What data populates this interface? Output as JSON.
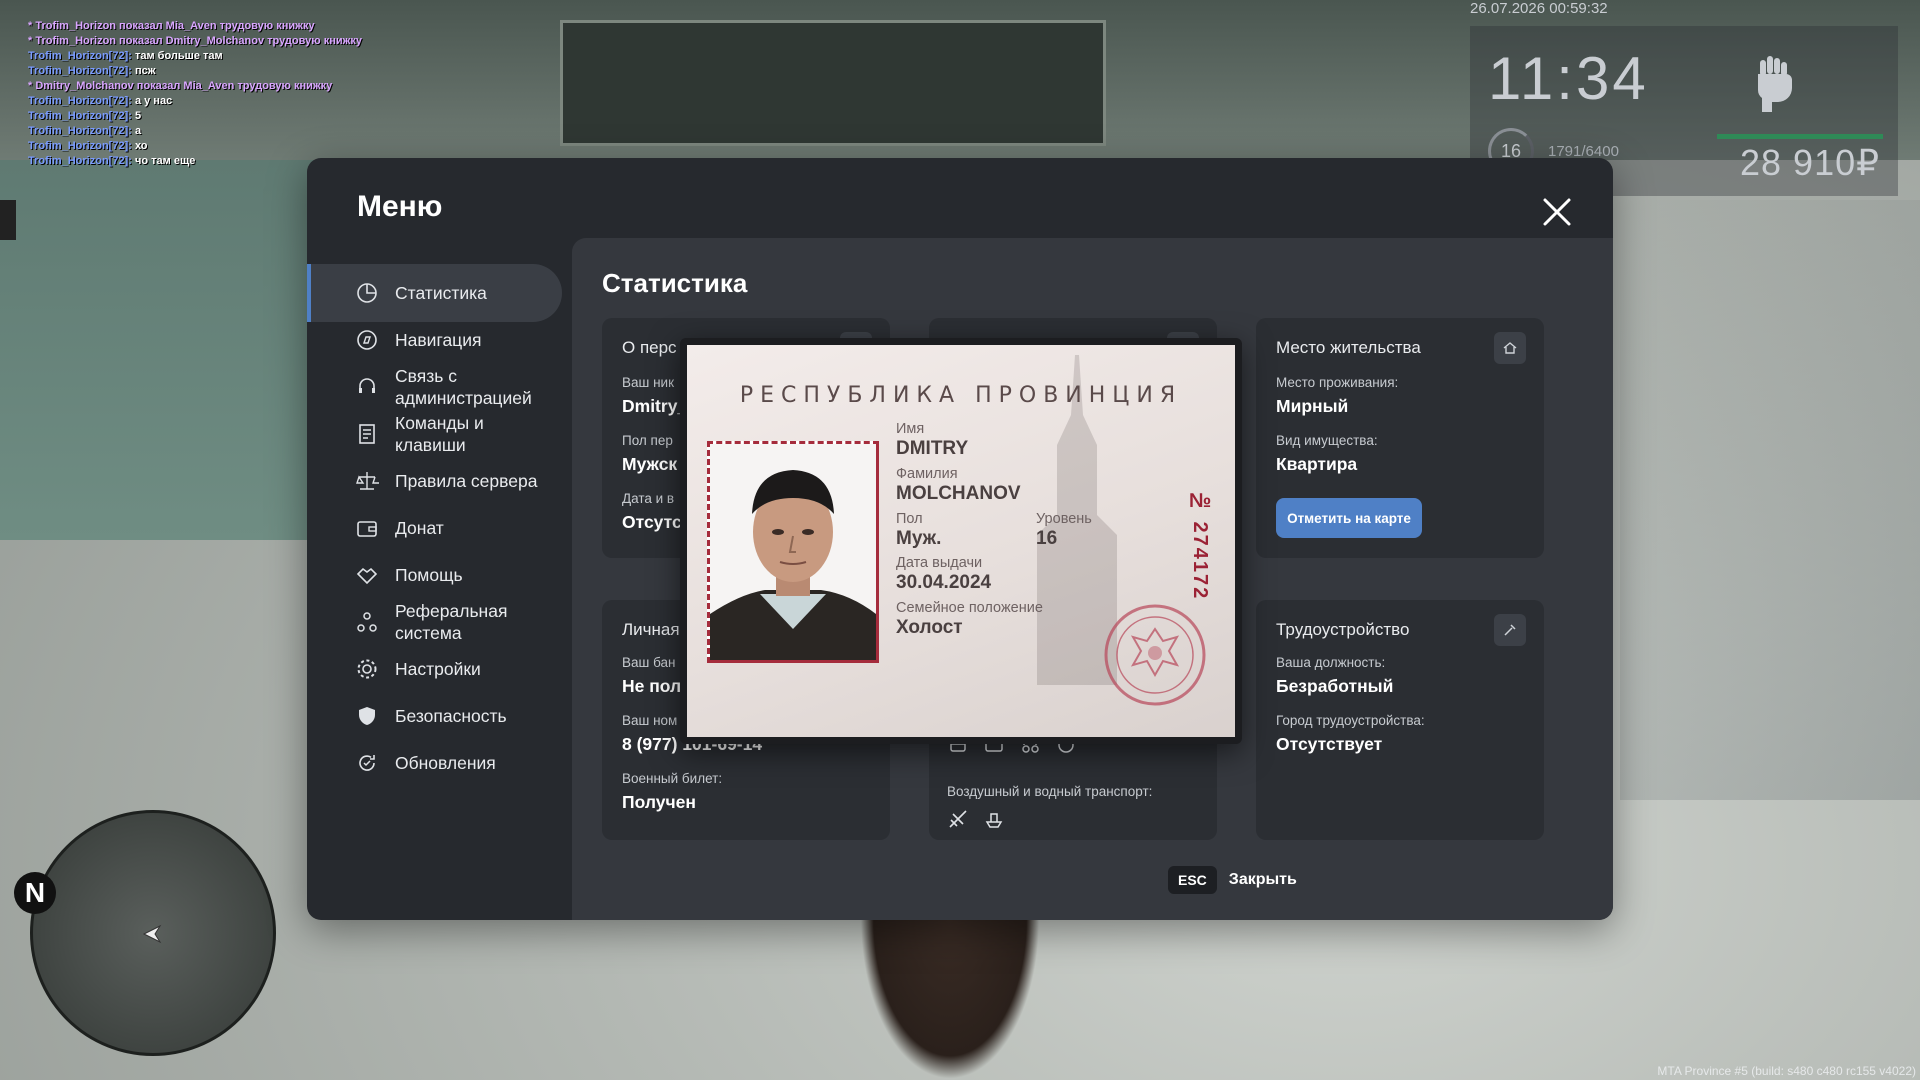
{
  "chat": [
    {
      "type": "me",
      "text": "* Trofim_Horizon показал Mia_Aven трудовую книжку"
    },
    {
      "type": "me",
      "text": "* Trofim_Horizon показал Dmitry_Molchanov трудовую книжку"
    },
    {
      "type": "say",
      "nick": "Trofim_Horizon[72]:",
      "msg": " там больше там"
    },
    {
      "type": "say",
      "nick": "Trofim_Horizon[72]:",
      "msg": " псж"
    },
    {
      "type": "me",
      "text": "* Dmitry_Molchanov показал Mia_Aven трудовую книжку"
    },
    {
      "type": "say",
      "nick": "Trofim_Horizon[72]:",
      "msg": " а у нас"
    },
    {
      "type": "say",
      "nick": "Trofim_Horizon[72]:",
      "msg": " 5"
    },
    {
      "type": "say",
      "nick": "Trofim_Horizon[72]:",
      "msg": " а"
    },
    {
      "type": "say",
      "nick": "Trofim_Horizon[72]:",
      "msg": " хо"
    },
    {
      "type": "say",
      "nick": "Trofim_Horizon[72]:",
      "msg": " чо там еще"
    }
  ],
  "hud": {
    "datetime": "26.07.2026 00:59:32",
    "time": "11:34",
    "level": "16",
    "xp": "1791/6400",
    "money": "28 910₽",
    "health_fraction": 1.0
  },
  "radar": {
    "north": "N"
  },
  "build_info": "MTA Province #5 (build: s480 c480 rc155 v4022)",
  "menu": {
    "title": "Меню",
    "sidebar": [
      {
        "label": "Статистика",
        "icon": "stats-icon",
        "active": true
      },
      {
        "label": "Навигация",
        "icon": "compass-icon"
      },
      {
        "label": "Связь с\nадминистрацией",
        "icon": "headset-icon"
      },
      {
        "label": "Команды и\nклавиши",
        "icon": "document-icon"
      },
      {
        "label": "Правила сервера",
        "icon": "scales-icon"
      },
      {
        "label": "Донат",
        "icon": "wallet-icon"
      },
      {
        "label": "Помощь",
        "icon": "handshake-icon"
      },
      {
        "label": "Реферальная\nсистема",
        "icon": "referral-icon"
      },
      {
        "label": "Настройки",
        "icon": "gear-icon"
      },
      {
        "label": "Безопасность",
        "icon": "shield-icon"
      },
      {
        "label": "Обновления",
        "icon": "refresh-icon"
      }
    ],
    "content_title": "Статистика",
    "card_personal": {
      "title": "О перс",
      "nick_label": "Ваш ник",
      "nick_value": "Dmitry_",
      "gender_label": "Пол пер",
      "gender_value": "Мужск",
      "date_label": "Дата и в",
      "date_value": "Отсутс"
    },
    "card_residence": {
      "title": "Место жительства",
      "place_label": "Место проживания:",
      "place_value": "Мирный",
      "property_label": "Вид имущества:",
      "property_value": "Квартира",
      "map_button": "Отметить на карте"
    },
    "card_private": {
      "title": "Личная",
      "bank_label": "Ваш бан",
      "bank_value": "Не пол",
      "phone_label": "Ваш ном",
      "phone_value": "8 (977) 101-69-14",
      "military_label": "Военный билет:",
      "military_value": "Получен"
    },
    "card_transport": {
      "air_label": "Воздушный и водный транспорт:"
    },
    "card_job": {
      "title": "Трудоустройство",
      "position_label": "Ваша должность:",
      "position_value": "Безработный",
      "city_label": "Город трудоустройства:",
      "city_value": "Отсутствует"
    },
    "esc_key": "ESC",
    "esc_label": "Закрыть"
  },
  "passport": {
    "header": "РЕСПУБЛИКА ПРОВИНЦИЯ",
    "name_label": "Имя",
    "name_value": "DMITRY",
    "surname_label": "Фамилия",
    "surname_value": "MOLCHANOV",
    "gender_label": "Пол",
    "gender_value": "Муж.",
    "level_label": "Уровень",
    "level_value": "16",
    "issue_label": "Дата выдачи",
    "issue_value": "30.04.2024",
    "marital_label": "Семейное положение",
    "marital_value": "Холост",
    "number": "№ 274172"
  },
  "colors": {
    "accent": "#4f80c6",
    "panel": "#26292e",
    "content": "#35383e",
    "card": "#2b2e33",
    "passport_red": "#9b2235"
  }
}
